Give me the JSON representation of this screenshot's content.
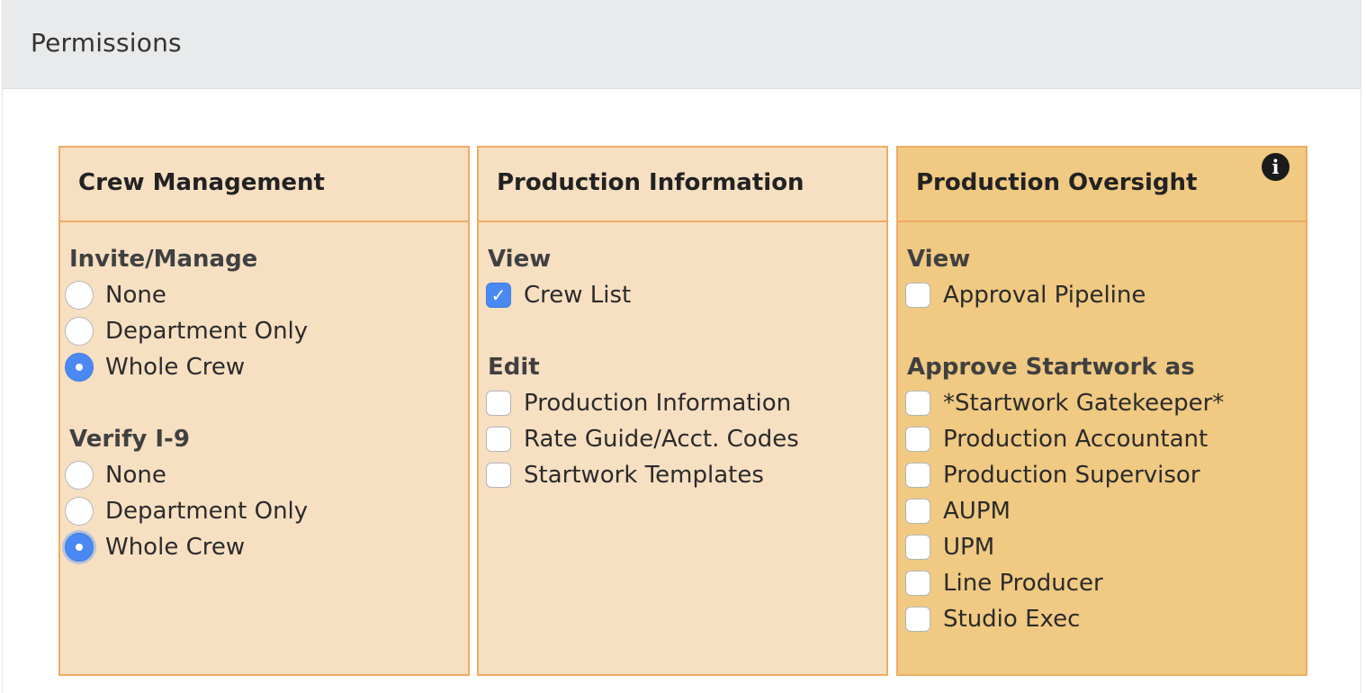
{
  "header": {
    "title": "Permissions"
  },
  "panels": [
    {
      "title": "Crew Management",
      "groups": [
        {
          "label": "Invite/Manage",
          "options": [
            {
              "label": "None",
              "selected": false
            },
            {
              "label": "Department Only",
              "selected": false
            },
            {
              "label": "Whole Crew",
              "selected": true
            }
          ]
        },
        {
          "label": "Verify I-9",
          "options": [
            {
              "label": "None",
              "selected": false
            },
            {
              "label": "Department Only",
              "selected": false
            },
            {
              "label": "Whole Crew",
              "selected": true
            }
          ]
        }
      ]
    },
    {
      "title": "Production Information",
      "groups": [
        {
          "label": "View",
          "options": [
            {
              "label": "Crew List",
              "checked": true
            }
          ]
        },
        {
          "label": "Edit",
          "options": [
            {
              "label": "Production Information",
              "checked": false
            },
            {
              "label": "Rate Guide/Acct. Codes",
              "checked": false
            },
            {
              "label": "Startwork Templates",
              "checked": false
            }
          ]
        }
      ]
    },
    {
      "title": "Production Oversight",
      "info_icon": "info-icon",
      "groups": [
        {
          "label": "View",
          "options": [
            {
              "label": "Approval Pipeline",
              "checked": false
            }
          ]
        },
        {
          "label": "Approve Startwork as",
          "options": [
            {
              "label": "*Startwork Gatekeeper*",
              "checked": false
            },
            {
              "label": "Production Accountant",
              "checked": false
            },
            {
              "label": "Production Supervisor",
              "checked": false
            },
            {
              "label": "AUPM",
              "checked": false
            },
            {
              "label": "UPM",
              "checked": false
            },
            {
              "label": "Line Producer",
              "checked": false
            },
            {
              "label": "Studio Exec",
              "checked": false
            }
          ]
        }
      ]
    }
  ],
  "colors": {
    "header_bg": "#e9eaeb",
    "panel_bg": "#f7dfc2",
    "panel_bg_highlight": "#f0c982",
    "panel_border": "#eeac62",
    "control_accent": "#4a89f3"
  }
}
